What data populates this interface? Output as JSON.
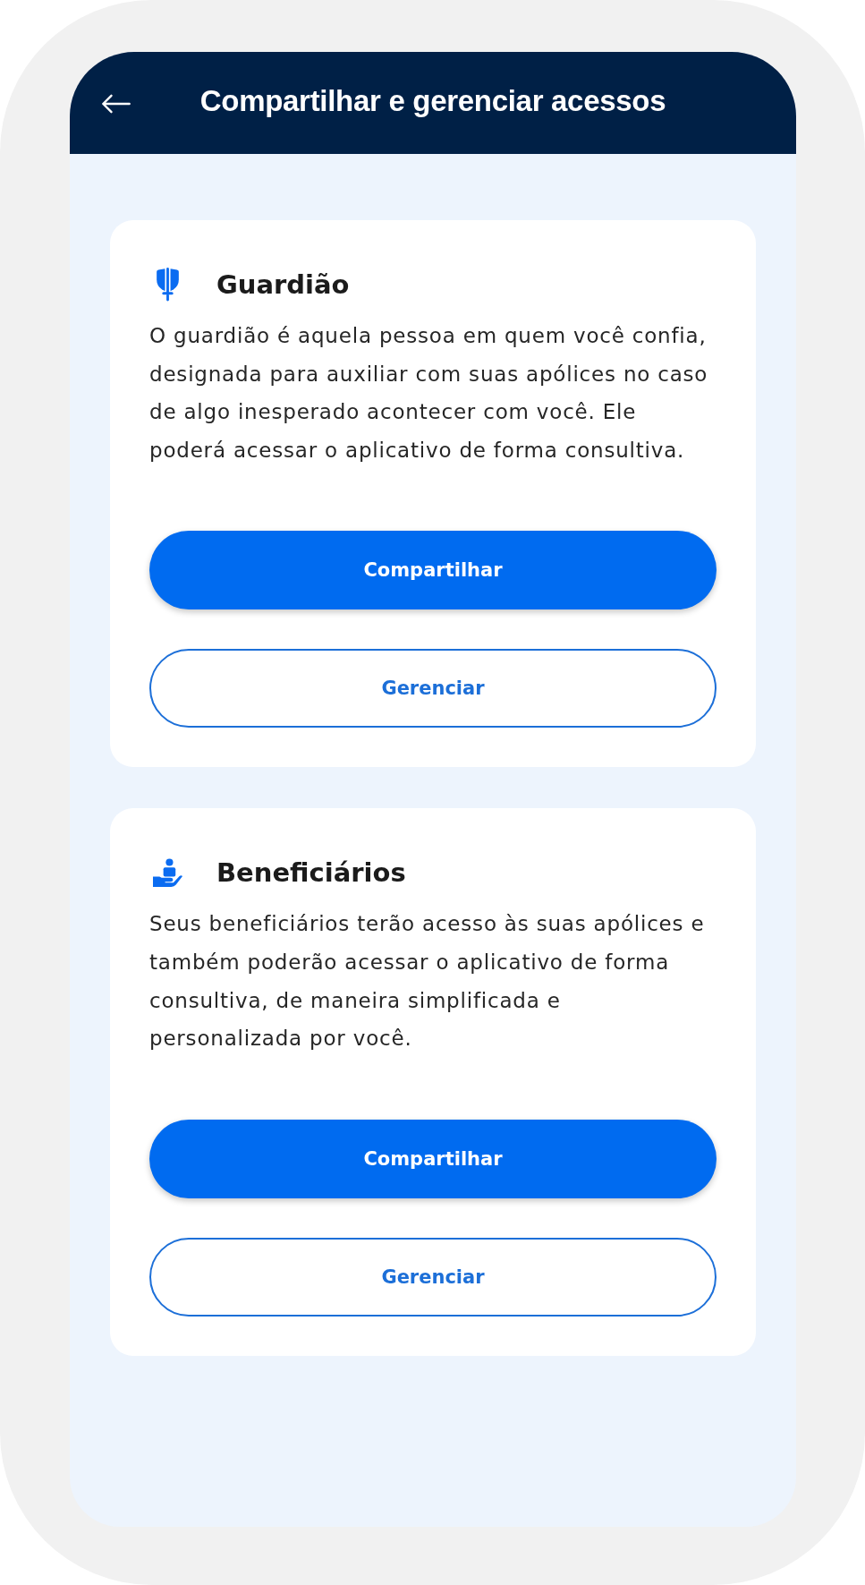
{
  "header": {
    "title": "Compartilhar e gerenciar acessos"
  },
  "cards": [
    {
      "kind": "guardian",
      "title": "Guardião",
      "description": "O guardião é aquela pessoa em quem você confia, designada para auxiliar com suas apólices no caso de algo inesperado acontecer com você. Ele poderá acessar o aplicativo de forma consultiva.",
      "buttons": [
        {
          "kind": "primary",
          "label": "Compartilhar"
        },
        {
          "kind": "outline",
          "label": "Gerenciar"
        }
      ]
    },
    {
      "kind": "beneficiaries",
      "title": "Beneficiários",
      "description": "Seus beneficiários terão acesso às suas apólices e também poderão acessar o aplicativo de forma consultiva, de maneira simplificada e personalizada por você.",
      "buttons": [
        {
          "kind": "primary",
          "label": "Compartilhar"
        },
        {
          "kind": "outline",
          "label": "Gerenciar"
        }
      ]
    }
  ]
}
